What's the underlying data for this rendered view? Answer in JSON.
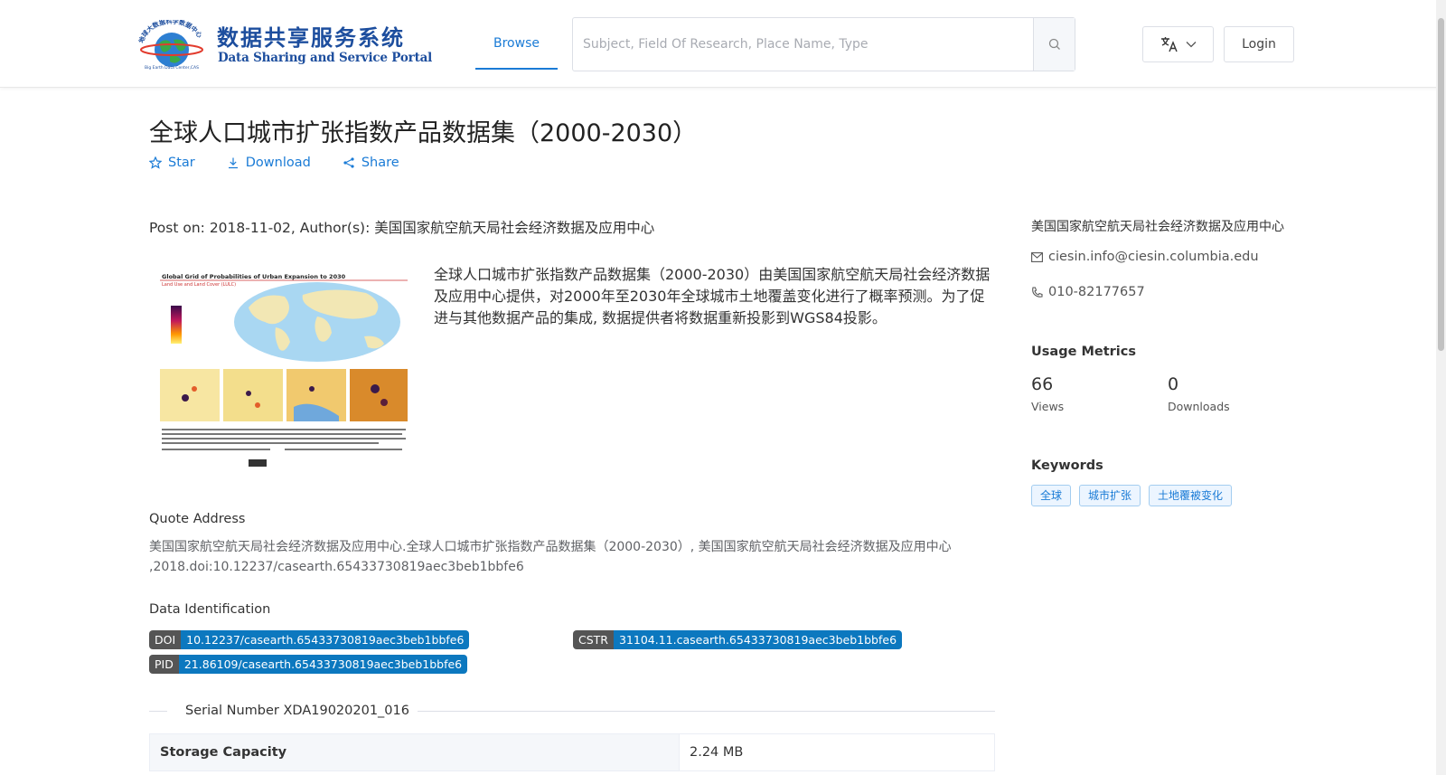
{
  "header": {
    "logo_cn": "数据共享服务系统",
    "logo_en": "Data Sharing and Service Portal",
    "logo_arc_text": "地球大数据科学数据中心",
    "logo_ring_text": "Big Earth Data Center,CAS",
    "nav_browse": "Browse",
    "search_placeholder": "Subject, Field Of Research, Place Name, Type",
    "login": "Login"
  },
  "dataset": {
    "title": "全球人口城市扩张指数产品数据集（2000-2030）",
    "actions": {
      "star": "Star",
      "download": "Download",
      "share": "Share"
    },
    "post_line": "Post on: 2018-11-02, Author(s): 美国国家航空航天局社会经济数据及应用中心",
    "description": "全球人口城市扩张指数产品数据集（2000-2030）由美国国家航空航天局社会经济数据及应用中心提供，对2000年至2030年全球城市土地覆盖变化进行了概率预测。为了促进与其他数据产品的集成, 数据提供者将数据重新投影到WGS84投影。",
    "thumbnail": {
      "title": "Global Grid of Probabilities of Urban Expansion to 2030",
      "subtitle": "Land Use and Land Cover (LULC)"
    },
    "quote_title": "Quote Address",
    "quote_text": "美国国家航空航天局社会经济数据及应用中心.全球人口城市扩张指数产品数据集（2000-2030）, 美国国家航空航天局社会经济数据及应用中心 ,2018.doi:10.12237/casearth.65433730819aec3beb1bbfe6",
    "ident_title": "Data Identification",
    "identifiers": {
      "doi_key": "DOI",
      "doi": "10.12237/casearth.65433730819aec3beb1bbfe6",
      "cstr_key": "CSTR",
      "cstr": "31104.11.casearth.65433730819aec3beb1bbfe6",
      "pid_key": "PID",
      "pid": "21.86109/casearth.65433730819aec3beb1bbfe6"
    },
    "serial": "Serial Number XDA19020201_016",
    "table": [
      {
        "key": "Storage Capacity",
        "value": "2.24 MB"
      }
    ]
  },
  "sidebar": {
    "org": "美国国家航空航天局社会经济数据及应用中心",
    "email": "ciesin.info@ciesin.columbia.edu",
    "phone": "010-82177657",
    "usage_title": "Usage Metrics",
    "views_value": "66",
    "views_label": "Views",
    "downloads_value": "0",
    "downloads_label": "Downloads",
    "keywords_title": "Keywords",
    "keywords": [
      "全球",
      "城市扩张",
      "土地覆被变化"
    ]
  },
  "colors": {
    "accent": "#1a7bd6",
    "tag_value": "#0c78bf",
    "tag_key": "#555555"
  }
}
